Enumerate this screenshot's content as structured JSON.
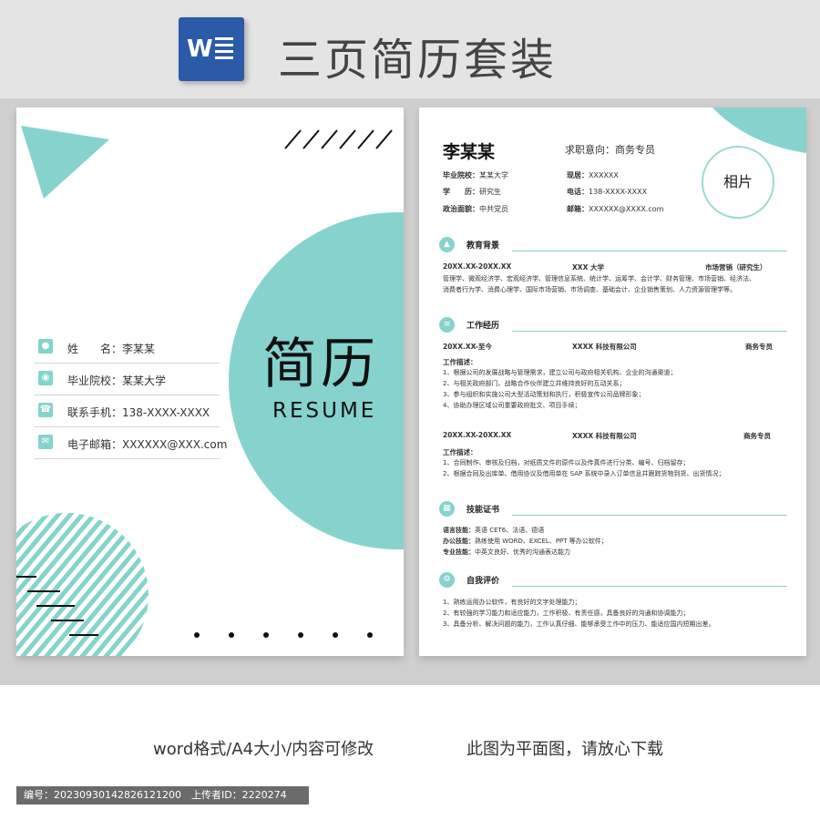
{
  "header": {
    "title": "三页简历套装",
    "logo_letter": "W"
  },
  "cover": {
    "title": "简历",
    "subtitle": "RESUME",
    "rows": [
      {
        "label": "姓　　名：李某某"
      },
      {
        "label": "毕业院校：某某大学"
      },
      {
        "label": "联系手机：138-XXXX-XXXX"
      },
      {
        "label": "电子邮箱：XXXXXX@XXX.com"
      }
    ]
  },
  "resume": {
    "name": "李某某",
    "intent": "求职意向：商务专员",
    "photo": "相片",
    "basic": {
      "school_k": "毕业院校：",
      "school_v": "某某大学",
      "edu_k": "学　　历：",
      "edu_v": "研究生",
      "party_k": "政治面貌：",
      "party_v": "中共党员",
      "home_k": "现居：",
      "home_v": "XXXXXX",
      "phone_k": "电话：",
      "phone_v": "138-XXXX-XXXX",
      "mail_k": "邮箱：",
      "mail_v": "XXXXXX@XXXX.com"
    },
    "education": {
      "title": "教育背景",
      "period": "20XX.XX-20XX.XX",
      "school": "XXX 大学",
      "major": "市场营销（研究生）",
      "lines": [
        "管理学、微观经济学、宏观经济学、管理信息系统、统计学、运筹学、会计学、财务管理、市场营销、经济法、",
        "消费者行为学、消费心理学、国际市场营销、市场调查、基础会计、企业销售策划、人力资源管理学等。"
      ]
    },
    "work": {
      "title": "工作经历",
      "jobs": [
        {
          "period": "20XX.XX-至今",
          "company": "XXXX 科技有限公司",
          "role": "商务专员",
          "desc_title": "工作描述：",
          "lines": [
            "1、根据公司的发展战略与管理需求，建立公司与政府相关机构、企业的沟通渠道；",
            "2、与相关政府部门、战略合作伙伴建立并维持良好的互动关系；",
            "3、参与组织和实施公司大型活动策划和执行，积极宣传公司品牌形象；",
            "4、协助办理区域公司重要政府批文、项目手续；"
          ]
        },
        {
          "period": "20XX.XX-20XX.XX",
          "company": "XXXX 科技有限公司",
          "role": "商务专员",
          "desc_title": "工作描述：",
          "lines": [
            "1、合同制作、审核及归档，对纸质文件的原件以及传真件进行分类、编号、归档留存；",
            "2、根据合同及出库单、借用协议及借用单在 SAP 系统中录入订单信息并跟踪货物到货、出货情况；"
          ]
        }
      ]
    },
    "skills": {
      "title": "技能证书",
      "lines": [
        {
          "k": "语言技能：",
          "v": "英语 CET6、法语、德语"
        },
        {
          "k": "办公技能：",
          "v": "熟练使用 WORD、EXCEL、PPT 等办公软件；"
        },
        {
          "k": "专业技能：",
          "v": "中英文良好、优秀的沟通表达能力"
        }
      ]
    },
    "self": {
      "title": "自我评价",
      "lines": [
        "1、熟练运用办公软件，有良好的文字处理能力；",
        "2、有较强的学习能力和适应能力，工作积极、有责任感，具备良好的沟通和协调能力；",
        "3、具备分析、解决问题的能力，工作认真仔细、能够承受工作中的压力、能适应国内短期出差。"
      ]
    }
  },
  "footer": {
    "left": "word格式/A4大小/内容可修改",
    "right": "此图为平面图，请放心下载",
    "meta": "编号：20230930142826121200　上传者ID：2220274"
  }
}
